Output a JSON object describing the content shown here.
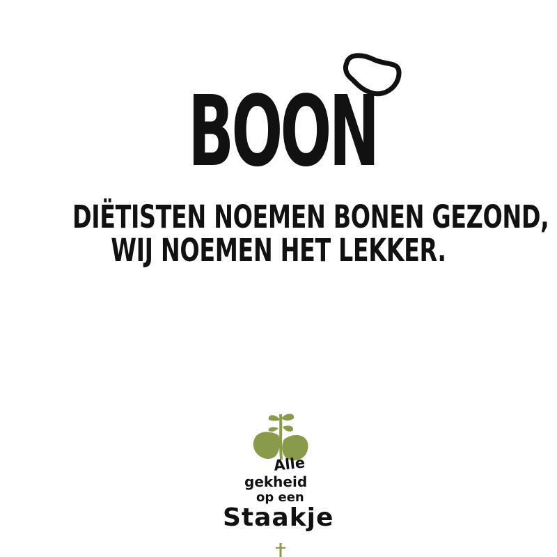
{
  "brand": {
    "name": "BOON",
    "icon": "bean-sprout-icon"
  },
  "tagline": {
    "line1": "DIËTISTEN NOEMEN BONEN GEZOND,",
    "line2": "WIJ NOEMEN HET LEKKER."
  },
  "plant_logo": {
    "line1": "Alle",
    "line2": "gekheid",
    "line3": "op een",
    "line4": "Staakje",
    "icon": "bean-plant-icon",
    "leaf_color": "#8a9a4b"
  },
  "colors": {
    "background": "#ffffff",
    "text": "#111111"
  }
}
